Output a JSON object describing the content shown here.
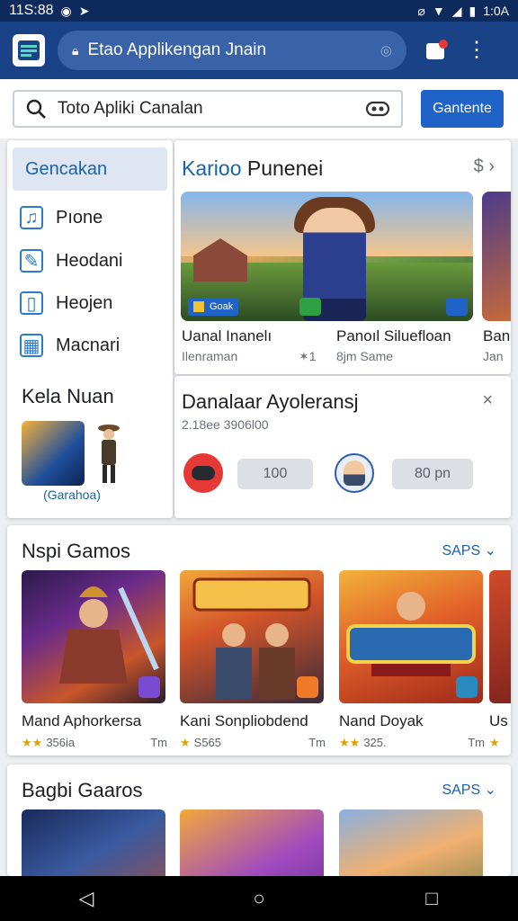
{
  "status": {
    "time": "11S:88",
    "clock": "1:0A"
  },
  "urlbar": {
    "text": "Etao Applikengan Jnain"
  },
  "search": {
    "value": "Toto Apliki Canalan",
    "button": "Gantente"
  },
  "sidebar": {
    "selected": "Gencakan",
    "items": [
      {
        "label": "Pıone",
        "icon": "music-icon"
      },
      {
        "label": "Heodani",
        "icon": "pencil-icon"
      },
      {
        "label": "Heojen",
        "icon": "book-icon"
      },
      {
        "label": "Macnari",
        "icon": "calendar-icon"
      }
    ],
    "section": "Kela Nuan",
    "caption": "(Garahoa)"
  },
  "recommended": {
    "title_blue": "Karioo",
    "title_rest": "Punenei",
    "arrow_left": "$",
    "arrow_right": "›",
    "badge": "Goak",
    "items": [
      {
        "name": "Uanal Inanelı",
        "sub": "Ilenraman",
        "meta": "✶1"
      },
      {
        "name": "Panoıl Siluefloan",
        "sub": "8jm Same"
      },
      {
        "name": "Ban",
        "sub": "Jan"
      }
    ]
  },
  "downloads": {
    "title": "Danalaar Ayoleransj",
    "close": "×",
    "subtitle": "2.18ee 3906l00",
    "pill1": "100",
    "pill2": "80 pn"
  },
  "section1": {
    "title": "Nspi Gamos",
    "more": "SAPS ⌄",
    "cards": [
      {
        "name": "Mand Aphorkersa",
        "rating": "★★",
        "score": "356ia",
        "size": "Tm"
      },
      {
        "name": "Kani Sonpliobdend",
        "rating": "★",
        "score": "S565",
        "size": "Tm"
      },
      {
        "name": "Nand Doyak",
        "rating": "★★",
        "score": "325.",
        "size": "Tm"
      },
      {
        "name": "Us",
        "rating": "★",
        "score": "",
        "size": ""
      }
    ]
  },
  "section2": {
    "title": "Bagbi Gaaros",
    "more": "SAPS ⌄"
  },
  "navbar": {
    "back": "◁",
    "home": "○",
    "recents": "□"
  },
  "colors": {
    "appbar": "#1a4287",
    "accent": "#1f63c9",
    "link": "#1a63a8"
  }
}
